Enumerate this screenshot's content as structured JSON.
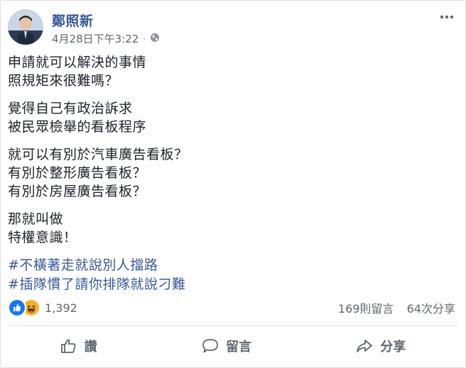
{
  "post": {
    "author": "鄭照新",
    "timestamp": "4月28日下午3:22",
    "privacy_icon": "globe-icon",
    "paragraphs": [
      [
        "申請就可以解決的事情",
        "照規矩來很難嗎？"
      ],
      [
        "覺得自己有政治訴求",
        "被民眾檢舉的看板程序"
      ],
      [
        "就可以有別於汽車廣告看板？",
        "有別於整形廣告看板？",
        "有別於房屋廣告看板？"
      ],
      [
        "那就叫做",
        "特權意識！"
      ]
    ],
    "hashtags": [
      "#不橫著走就說別人擋路",
      "#插隊慣了請你排隊就說刁難"
    ]
  },
  "stats": {
    "reaction_icons": [
      "like-icon",
      "haha-icon"
    ],
    "reaction_count": "1,392",
    "comments": "169則留言",
    "shares": "64次分享"
  },
  "actions": {
    "like": "讚",
    "comment": "留言",
    "share": "分享"
  },
  "colors": {
    "link": "#365899",
    "text": "#1d2129",
    "muted": "#616770",
    "like_blue": "#1877f2",
    "haha_yellow": "#f7b125"
  }
}
